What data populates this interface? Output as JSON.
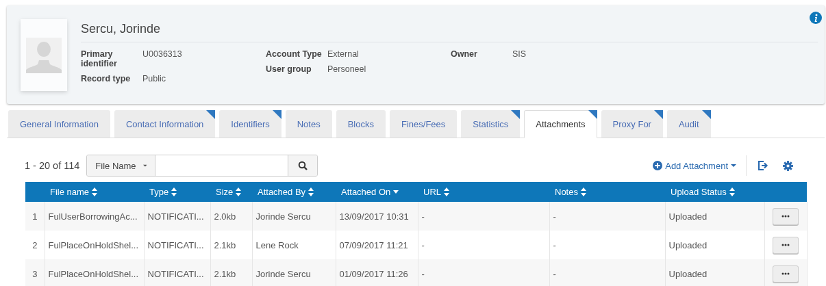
{
  "user": {
    "name": "Sercu, Jorinde",
    "field_groups": [
      [
        {
          "label": "Primary identifier",
          "value": "U0036313"
        },
        {
          "label": "Record type",
          "value": "Public"
        }
      ],
      [
        {
          "label": "Account Type",
          "value": "External"
        },
        {
          "label": "User group",
          "value": "Personeel"
        }
      ],
      [
        {
          "label": "Owner",
          "value": "SIS"
        }
      ]
    ]
  },
  "tabs": [
    {
      "label": "General Information",
      "selected": false,
      "flagged": false
    },
    {
      "label": "Contact Information",
      "selected": false,
      "flagged": true
    },
    {
      "label": "Identifiers",
      "selected": false,
      "flagged": true
    },
    {
      "label": "Notes",
      "selected": false,
      "flagged": false
    },
    {
      "label": "Blocks",
      "selected": false,
      "flagged": false
    },
    {
      "label": "Fines/Fees",
      "selected": false,
      "flagged": false
    },
    {
      "label": "Statistics",
      "selected": false,
      "flagged": true
    },
    {
      "label": "Attachments",
      "selected": true,
      "flagged": true
    },
    {
      "label": "Proxy For",
      "selected": false,
      "flagged": true
    },
    {
      "label": "Audit",
      "selected": false,
      "flagged": true
    }
  ],
  "toolbar": {
    "count": "1 - 20 of 114",
    "search_scope": "File Name",
    "add_button": "Add Attachment"
  },
  "table": {
    "columns": [
      {
        "label": "File name",
        "sorted": false
      },
      {
        "label": "Type",
        "sorted": false
      },
      {
        "label": "Size",
        "sorted": false
      },
      {
        "label": "Attached By",
        "sorted": false
      },
      {
        "label": "Attached On",
        "sorted": true
      },
      {
        "label": "URL",
        "sorted": false
      },
      {
        "label": "Notes",
        "sorted": false
      },
      {
        "label": "Upload Status",
        "sorted": false
      }
    ],
    "rows": [
      {
        "index": "1",
        "cells": [
          "FulUserBorrowingAc...",
          "NOTIFICATI...",
          "2.0kb",
          "Jorinde Sercu",
          "13/09/2017 10:31",
          "-",
          "-",
          "Uploaded"
        ]
      },
      {
        "index": "2",
        "cells": [
          "FulPlaceOnHoldShel...",
          "NOTIFICATI...",
          "2.1kb",
          "Lene Rock",
          "07/09/2017 11:21",
          "-",
          "-",
          "Uploaded"
        ]
      },
      {
        "index": "3",
        "cells": [
          "FulPlaceOnHoldShel...",
          "NOTIFICATI...",
          "2.1kb",
          "Jorinde Sercu",
          "01/09/2017 11:26",
          "-",
          "-",
          "Uploaded"
        ]
      }
    ]
  }
}
